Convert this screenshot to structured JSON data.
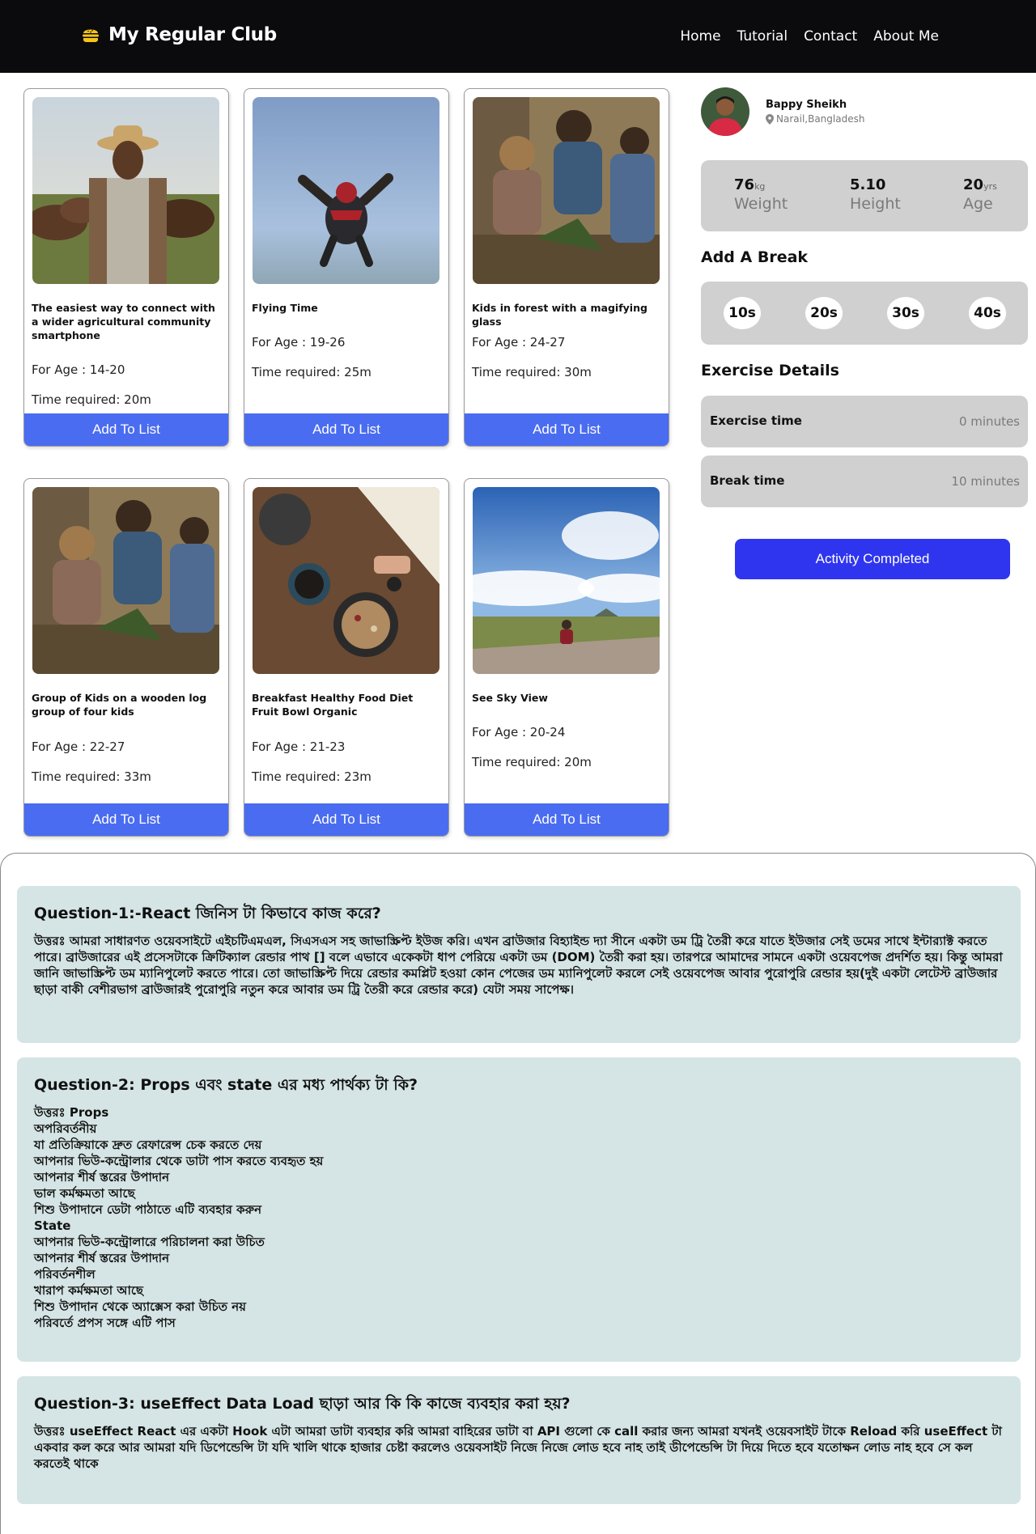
{
  "nav": {
    "brand": "My Regular Club",
    "links": [
      "Home",
      "Tutorial",
      "Contact",
      "About Me"
    ]
  },
  "cards": [
    {
      "title": "The easiest way to connect with a wider agricultural community smartphone",
      "age": "For Age : 14-20",
      "time": "Time required: 20m",
      "button": "Add To List"
    },
    {
      "title": "Flying Time",
      "age": "For Age : 19-26",
      "time": "Time required: 25m",
      "button": "Add To List"
    },
    {
      "title": "Kids in forest with a magifying glass",
      "age": "For Age : 24-27",
      "time": "Time required: 30m",
      "button": "Add To List"
    },
    {
      "title": "Group of Kids on a wooden log group of four kids",
      "age": "For Age : 22-27",
      "time": "Time required: 33m",
      "button": "Add To List"
    },
    {
      "title": "Breakfast Healthy Food Diet Fruit Bowl Organic",
      "age": "For Age : 21-23",
      "time": "Time required: 23m",
      "button": "Add To List"
    },
    {
      "title": "See Sky View",
      "age": "For Age : 20-24",
      "time": "Time required: 20m",
      "button": "Add To List"
    }
  ],
  "profile": {
    "name": "Bappy Sheikh",
    "location": "Narail,Bangladesh"
  },
  "stats": [
    {
      "value": "76",
      "unit": "kg",
      "label": "Weight"
    },
    {
      "value": "5.10",
      "unit": "",
      "label": "Height"
    },
    {
      "value": "20",
      "unit": "yrs",
      "label": "Age"
    }
  ],
  "break_heading": "Add A Break",
  "breaks": [
    "10s",
    "20s",
    "30s",
    "40s"
  ],
  "details_heading": "Exercise Details",
  "details": [
    {
      "label": "Exercise time",
      "value": "0 minutes"
    },
    {
      "label": "Break time",
      "value": "10 minutes"
    }
  ],
  "complete_button": "Activity Completed",
  "questions": [
    {
      "q": "Question-1:-React জিনিস টা কিভাবে কাজ করে?",
      "a": "উত্তরঃ আমরা সাধারণত ওয়েবসাইটে এইচটিএমএল, সিএসএস সহ জাভাস্ক্রিপ্ট ইউজ করি। এখন ব্রাউজার বিহ্যাইন্ড দ্যা সীনে একটা ডম ট্রি তৈরী করে যাতে ইউজার সেই ডমের সাথে ইন্টার‍্যাক্ট করতে পারে। ব্রাউজারের এই প্রসেসটাকে ক্রিটিক্যাল রেন্ডার পাথ [] বলে এভাবে একেকটা ধাপ পেরিয়ে একটা ডম (DOM) তৈরী করা হয়। তারপরে আমাদের সামনে একটা ওয়েবপেজ প্রদর্শিত হয়। কিন্তু আমরা জানি জাভাস্ক্রিপ্ট ডম ম্যানিপুলেট করতে পারে। তো জাভাস্ক্রিপ্ট দিয়ে রেন্ডার কমপ্লিট হওয়া কোন পেজের ডম ম্যানিপুলেট করলে সেই ওয়েবপেজ আবার পুরোপুরি রেন্ডার হয়(দুই একটা লেটেস্ট ব্রাউজার ছাড়া বাকী বেশীরভাগ ব্রাউজারই পুরোপুরি নতুন করে আবার ডম ট্রি তৈরী করে রেন্ডার করে) যেটা সময় সাপেক্ষ।"
    },
    {
      "q": "Question-2: Props এবং state এর মধ্য পার্থক্য টা কি?",
      "lines": [
        "উত্তরঃ Props",
        "অপরিবর্তনীয়",
        "যা প্রতিক্রিয়াকে দ্রুত রেফারেন্স চেক করতে দেয়",
        "আপনার ভিউ-কন্ট্রোলার থেকে ডাটা পাস করতে ব্যবহৃত হয়",
        "আপনার শীর্ষ স্তরের উপাদান",
        "ভাল কর্মক্ষমতা আছে",
        "শিশু উপাদানে ডেটা পাঠাতে এটি ব্যবহার করুন",
        "State",
        "আপনার ভিউ-কন্ট্রোলারে পরিচালনা করা উচিত",
        "আপনার শীর্ষ স্তরের উপাদান",
        "পরিবর্তনশীল",
        "খারাপ কর্মক্ষমতা আছে",
        "শিশু উপাদান থেকে অ্যাক্সেস করা উচিত নয়",
        "পরিবর্তে প্রপস সঙ্গে এটি পাস"
      ]
    },
    {
      "q": "Question-3: useEffect Data Load ছাড়া আর কি কি কাজে ব্যবহার করা হয়?",
      "a": "উত্তরঃ useEffect React এর একটা Hook এটা আমরা ডাটা ব্যবহার করি আমরা বাহিরের ডাটা বা API গুলো কে call করার জন্য আমরা যখনই ওয়েবসাইট টাকে Reload করি useEffect টা একবার কল করে আর আমরা যদি ডিপেন্ডেন্সি টা যদি খালি থাকে হাজার চেষ্টা করলেও ওয়েবসাইট নিজে নিজে লোড হবে নাহ তাই ডীপেন্ডেন্সি টা দিয়ে দিতে হবে যতোক্ষন লোড নাহ হবে সে কল করতেই থাকে"
    }
  ]
}
